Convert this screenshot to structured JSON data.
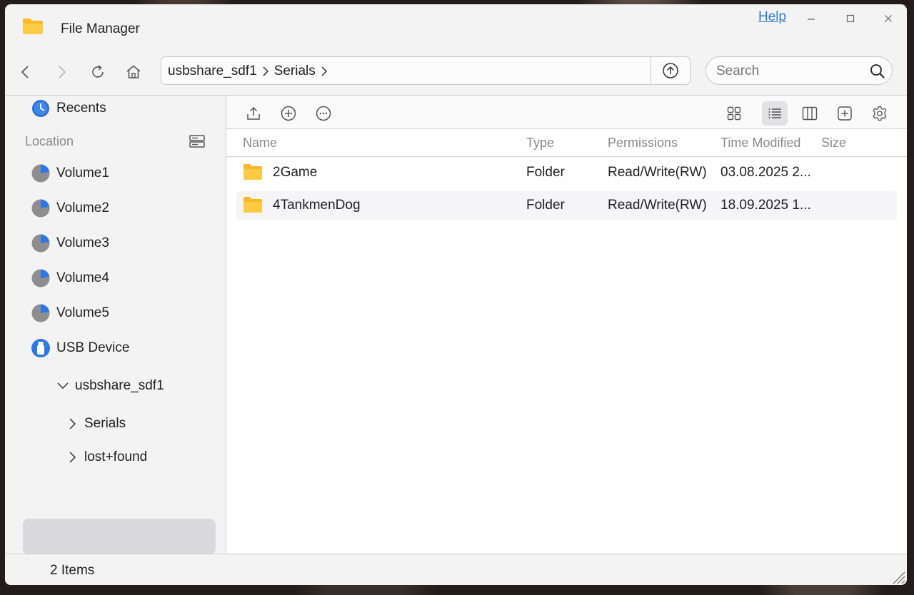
{
  "window": {
    "title": "File Manager",
    "help_label": "Help"
  },
  "nav": {
    "breadcrumb": [
      "usbshare_sdf1",
      "Serials"
    ],
    "search_placeholder": "Search"
  },
  "sidebar": {
    "recents_label": "Recents",
    "location_label": "Location",
    "volumes": [
      "Volume1",
      "Volume2",
      "Volume3",
      "Volume4",
      "Volume5"
    ],
    "usb_label": "USB Device",
    "tree": {
      "root": "usbshare_sdf1",
      "children": [
        "Serials",
        "lost+found"
      ]
    }
  },
  "table": {
    "columns": [
      "Name",
      "Type",
      "Permissions",
      "Time Modified",
      "Size"
    ],
    "rows": [
      {
        "name": "2Game",
        "type": "Folder",
        "permissions": "Read/Write(RW)",
        "modified": "03.08.2025 2...",
        "size": ""
      },
      {
        "name": "4TankmenDog",
        "type": "Folder",
        "permissions": "Read/Write(RW)",
        "modified": "18.09.2025 1...",
        "size": ""
      }
    ]
  },
  "status": {
    "items_text": "2 Items"
  },
  "icons": {
    "app": "folder-icon",
    "back": "chevron-left-icon",
    "forward": "chevron-right-icon",
    "refresh": "refresh-icon",
    "home": "home-icon",
    "up": "arrow-up-circle-icon",
    "search": "search-icon",
    "upload": "upload-icon",
    "new": "plus-circle-icon",
    "more": "more-circle-icon",
    "view_grid": "grid-view-icon",
    "view_list": "list-view-icon",
    "view_columns": "columns-view-icon",
    "new_folder": "add-square-icon",
    "settings": "gear-icon"
  },
  "colors": {
    "accent": "#2a7ad8",
    "folder": "#f7c23a",
    "window_bg": "#f4f3f4"
  }
}
